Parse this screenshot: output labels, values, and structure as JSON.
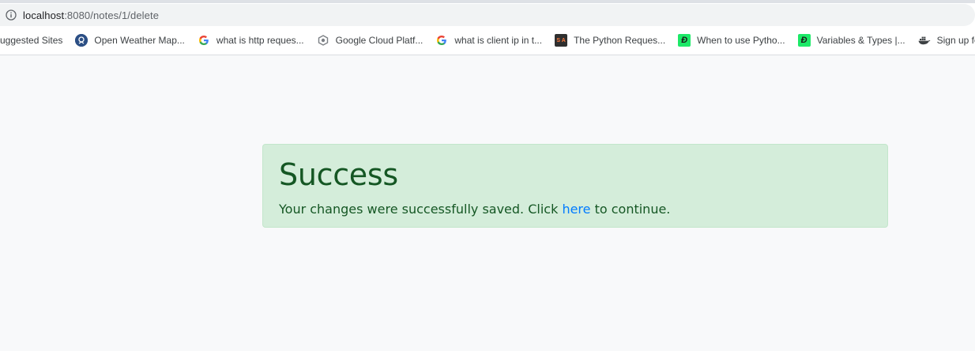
{
  "browser": {
    "url_host": "localhost",
    "url_rest": ":8080/notes/1/delete",
    "bookmarks": [
      {
        "label": "uggested Sites",
        "icon": "none"
      },
      {
        "label": "Open Weather Map...",
        "icon": "openweathermap-icon"
      },
      {
        "label": "what is http reques...",
        "icon": "google-icon"
      },
      {
        "label": "Google Cloud Platf...",
        "icon": "google-cloud-icon"
      },
      {
        "label": "what is client ip in t...",
        "icon": "google-icon"
      },
      {
        "label": "The Python Reques...",
        "icon": "sa-icon"
      },
      {
        "label": "When to use Pytho...",
        "icon": "datacamp-icon"
      },
      {
        "label": "Variables & Types |...",
        "icon": "datacamp-icon"
      },
      {
        "label": "Sign up for",
        "icon": "docker-icon"
      }
    ]
  },
  "alert": {
    "heading": "Success",
    "text_before": "Your changes were successfully saved. Click ",
    "link_text": "here",
    "text_after": " to continue."
  },
  "colors": {
    "alert_bg": "#d4edda",
    "alert_text": "#155724",
    "link": "#007bff",
    "page_bg": "#f8f9fa"
  }
}
